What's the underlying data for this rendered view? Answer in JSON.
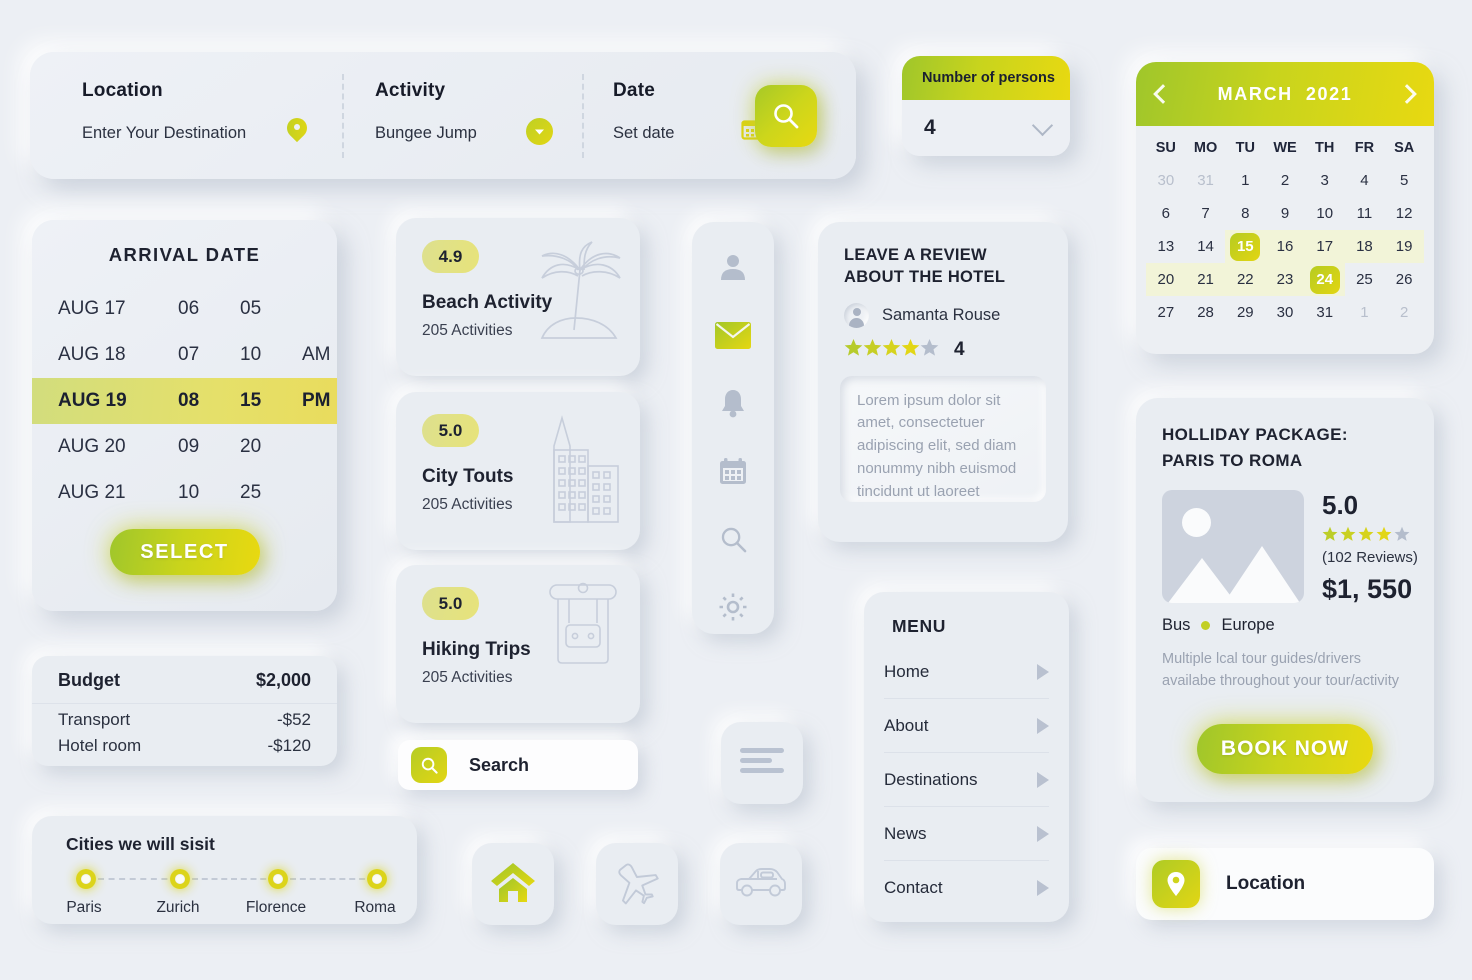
{
  "theme": {
    "background": "#eceff4",
    "accent_start": "#9fc62b",
    "accent_end": "#e8d911",
    "text": "#1e2230",
    "muted": "#9aa2b1"
  },
  "search_bar": {
    "fields": [
      {
        "label": "Location",
        "value": "Enter Your Destination",
        "icon": "map-pin-icon"
      },
      {
        "label": "Activity",
        "value": "Bungee Jump",
        "icon": "chevron-down-circle-icon"
      },
      {
        "label": "Date",
        "value": "Set date",
        "icon": "calendar-icon"
      }
    ],
    "submit_icon": "search-icon"
  },
  "persons": {
    "label": "Number of persons",
    "value": "4",
    "icon": "chevron-down-icon"
  },
  "calendar": {
    "month": "MARCH",
    "year": "2021",
    "prev_icon": "chevron-left-icon",
    "next_icon": "chevron-right-icon",
    "dow": [
      "SU",
      "MO",
      "TU",
      "WE",
      "TH",
      "FR",
      "SA"
    ],
    "weeks": [
      [
        {
          "d": "30",
          "state": "muted"
        },
        {
          "d": "31",
          "state": "muted"
        },
        {
          "d": "1",
          "state": "normal"
        },
        {
          "d": "2",
          "state": "normal"
        },
        {
          "d": "3",
          "state": "normal"
        },
        {
          "d": "4",
          "state": "normal"
        },
        {
          "d": "5",
          "state": "normal"
        }
      ],
      [
        {
          "d": "6",
          "state": "normal"
        },
        {
          "d": "7",
          "state": "normal"
        },
        {
          "d": "8",
          "state": "normal"
        },
        {
          "d": "9",
          "state": "normal"
        },
        {
          "d": "10",
          "state": "normal"
        },
        {
          "d": "11",
          "state": "normal"
        },
        {
          "d": "12",
          "state": "normal"
        }
      ],
      [
        {
          "d": "13",
          "state": "normal"
        },
        {
          "d": "14",
          "state": "normal"
        },
        {
          "d": "15",
          "state": "selected"
        },
        {
          "d": "16",
          "state": "inrange"
        },
        {
          "d": "17",
          "state": "inrange"
        },
        {
          "d": "18",
          "state": "inrange"
        },
        {
          "d": "19",
          "state": "inrange"
        }
      ],
      [
        {
          "d": "20",
          "state": "inrange"
        },
        {
          "d": "21",
          "state": "inrange"
        },
        {
          "d": "22",
          "state": "inrange"
        },
        {
          "d": "23",
          "state": "inrange"
        },
        {
          "d": "24",
          "state": "selected"
        },
        {
          "d": "25",
          "state": "normal"
        },
        {
          "d": "26",
          "state": "normal"
        }
      ],
      [
        {
          "d": "27",
          "state": "normal"
        },
        {
          "d": "28",
          "state": "normal"
        },
        {
          "d": "29",
          "state": "normal"
        },
        {
          "d": "30",
          "state": "normal"
        },
        {
          "d": "31",
          "state": "normal"
        },
        {
          "d": "1",
          "state": "muted"
        },
        {
          "d": "2",
          "state": "muted"
        }
      ]
    ]
  },
  "arrival": {
    "title": "ARRIVAL DATE",
    "rows": [
      {
        "date": "AUG 17",
        "hour": "06",
        "minute": "05",
        "meridiem": "",
        "selected": false
      },
      {
        "date": "AUG 18",
        "hour": "07",
        "minute": "10",
        "meridiem": "AM",
        "selected": false
      },
      {
        "date": "AUG 19",
        "hour": "08",
        "minute": "15",
        "meridiem": "PM",
        "selected": true
      },
      {
        "date": "AUG 20",
        "hour": "09",
        "minute": "20",
        "meridiem": "",
        "selected": false
      },
      {
        "date": "AUG 21",
        "hour": "10",
        "minute": "25",
        "meridiem": "",
        "selected": false
      }
    ],
    "select_label": "SELECT"
  },
  "budget": {
    "title": "Budget",
    "total": "$2,000",
    "items": [
      {
        "label": "Transport",
        "value": "-$52"
      },
      {
        "label": "Hotel room",
        "value": "-$120"
      }
    ]
  },
  "cities": {
    "title": "Cities we will sisit",
    "stops": [
      "Paris",
      "Zurich",
      "Florence",
      "Roma"
    ]
  },
  "activities": [
    {
      "rating": "4.9",
      "title": "Beach Activity",
      "subtitle": "205 Activities",
      "icon": "palm-tree-icon"
    },
    {
      "rating": "5.0",
      "title": "City Touts",
      "subtitle": "205 Activities",
      "icon": "city-buildings-icon"
    },
    {
      "rating": "5.0",
      "title": "Hiking Trips",
      "subtitle": "205 Activities",
      "icon": "backpack-icon"
    }
  ],
  "search_field": {
    "label": "Search",
    "icon": "search-icon"
  },
  "icon_rail": [
    {
      "name": "user-icon",
      "active": false
    },
    {
      "name": "envelope-icon",
      "active": true
    },
    {
      "name": "bell-icon",
      "active": false
    },
    {
      "name": "calendar-icon",
      "active": false
    },
    {
      "name": "search-icon",
      "active": false
    },
    {
      "name": "gear-icon",
      "active": false
    }
  ],
  "review": {
    "title": "LEAVE A REVIEW ABOUT THE HOTEL",
    "user": "Samanta Rouse",
    "rating": "4",
    "stars_filled": 4,
    "stars_total": 5,
    "text": "Lorem ipsum dolor sit amet, consectetuer adipiscing elit, sed diam nonummy nibh euismod tincidunt ut laoreet"
  },
  "menu": {
    "title": "MENU",
    "items": [
      "Home",
      "About",
      "Destinations",
      "News",
      "Contact"
    ]
  },
  "square_buttons": [
    {
      "icon": "list-lines-icon",
      "active": false
    },
    {
      "icon": "home-icon",
      "active": true
    },
    {
      "icon": "airplane-icon",
      "active": false
    },
    {
      "icon": "car-icon",
      "active": false
    }
  ],
  "package": {
    "title": "HOLLIDAY PACKAGE: PARIS TO ROMA",
    "title_line1": "HOLLIDAY PACKAGE:",
    "title_line2": "PARIS TO ROMA",
    "score": "5.0",
    "stars_filled": 4,
    "stars_total": 5,
    "reviews": "(102 Reviews)",
    "price": "$1, 550",
    "tag_transport": "Bus",
    "tag_region": "Europe",
    "description": "Multiple lcal tour guides/drivers availabe throughout your tour/activity",
    "book_label": "BOOK NOW",
    "image_icon": "placeholder-image-icon"
  },
  "location_button": {
    "label": "Location",
    "icon": "map-pin-icon"
  }
}
